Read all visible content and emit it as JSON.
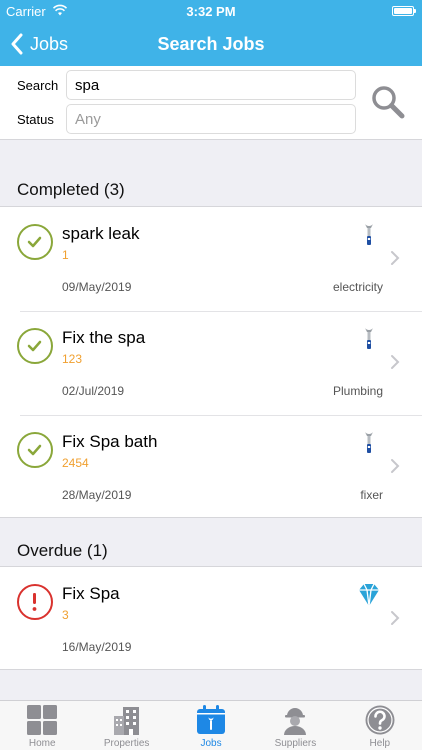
{
  "status_bar": {
    "carrier": "Carrier",
    "time": "3:32 PM"
  },
  "nav": {
    "back_label": "Jobs",
    "title": "Search Jobs"
  },
  "search": {
    "search_label": "Search",
    "search_value": "spa",
    "status_label": "Status",
    "status_placeholder": "Any"
  },
  "sections": [
    {
      "header": "Completed (3)",
      "jobs": [
        {
          "title": "spark leak",
          "number": "1",
          "date": "09/May/2019",
          "category": "electricity",
          "status": "completed",
          "icon": "wrench-icon"
        },
        {
          "title": "Fix the spa",
          "number": "123",
          "date": "02/Jul/2019",
          "category": "Plumbing",
          "status": "completed",
          "icon": "wrench-icon"
        },
        {
          "title": "Fix Spa bath",
          "number": "2454",
          "date": "28/May/2019",
          "category": "fixer",
          "status": "completed",
          "icon": "wrench-icon"
        }
      ]
    },
    {
      "header": "Overdue (1)",
      "jobs": [
        {
          "title": "Fix Spa",
          "number": "3",
          "date": "16/May/2019",
          "category": "",
          "status": "overdue",
          "icon": "diamond-logo-icon"
        }
      ]
    }
  ],
  "tabs": [
    {
      "label": "Home",
      "icon": "grid-icon",
      "active": false
    },
    {
      "label": "Properties",
      "icon": "building-icon",
      "active": false
    },
    {
      "label": "Jobs",
      "icon": "calendar-wrench-icon",
      "active": true
    },
    {
      "label": "Suppliers",
      "icon": "worker-icon",
      "active": false
    },
    {
      "label": "Help",
      "icon": "help-icon",
      "active": false
    }
  ],
  "colors": {
    "header_blue": "#3fb3e8",
    "completed_green": "#8aa73a",
    "overdue_red": "#d9322e",
    "job_number_orange": "#f0a030",
    "tab_active": "#1e88e5",
    "tab_inactive": "#8e8e93"
  }
}
